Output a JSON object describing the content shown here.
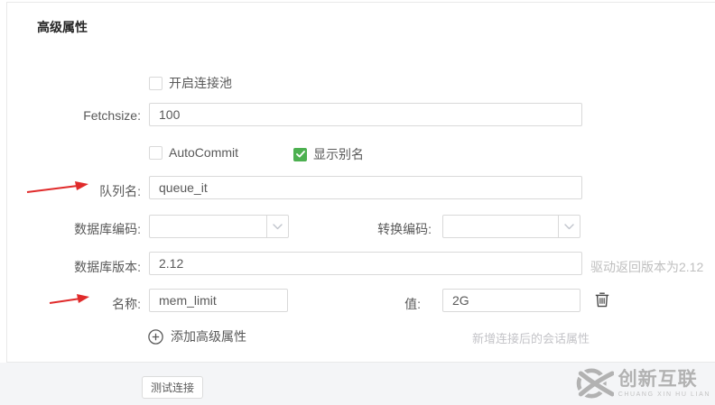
{
  "colors": {
    "accent_green": "#4cb050",
    "arrow_red": "#e02b2b",
    "input_border": "#d9d9d9",
    "panel_border": "#e9e9e9",
    "footer_bg": "#f4f5f7",
    "hint_gray": "#bfbfbf",
    "watermark_gray": "#b2b2b2"
  },
  "icons": {
    "select_arrow": "chevron-down-icon",
    "delete": "trash-icon",
    "add": "plus-circle-icon",
    "annotation": "red-arrow-icon",
    "checkbox_check": "check-icon",
    "brand": "cx-logo-icon"
  },
  "panel": {
    "title": "高级属性",
    "connection_pool": {
      "label": "开启连接池",
      "checked": false
    },
    "fetchsize": {
      "label": "Fetchsize:",
      "value": "100"
    },
    "autocommit": {
      "label": "AutoCommit",
      "checked": false
    },
    "show_alias": {
      "label": "显示别名",
      "checked": true
    },
    "queue_name": {
      "label": "队列名:",
      "value": "queue_it"
    },
    "db_encoding": {
      "label": "数据库编码:",
      "value": ""
    },
    "convert_encoding": {
      "label": "转换编码:",
      "value": ""
    },
    "db_version": {
      "label": "数据库版本:",
      "value": "2.12",
      "hint": "驱动返回版本为2.12"
    },
    "session_property": {
      "name_label": "名称:",
      "name_value": "mem_limit",
      "value_label": "值:",
      "value_value": "2G"
    },
    "add_property_label": "添加高级属性",
    "session_hint": "新增连接后的会话属性"
  },
  "footer": {
    "test_connection_label": "测试连接"
  },
  "watermark": {
    "brand": "创新互联",
    "brand_sub": "CHUANG XIN HU LIAN"
  }
}
